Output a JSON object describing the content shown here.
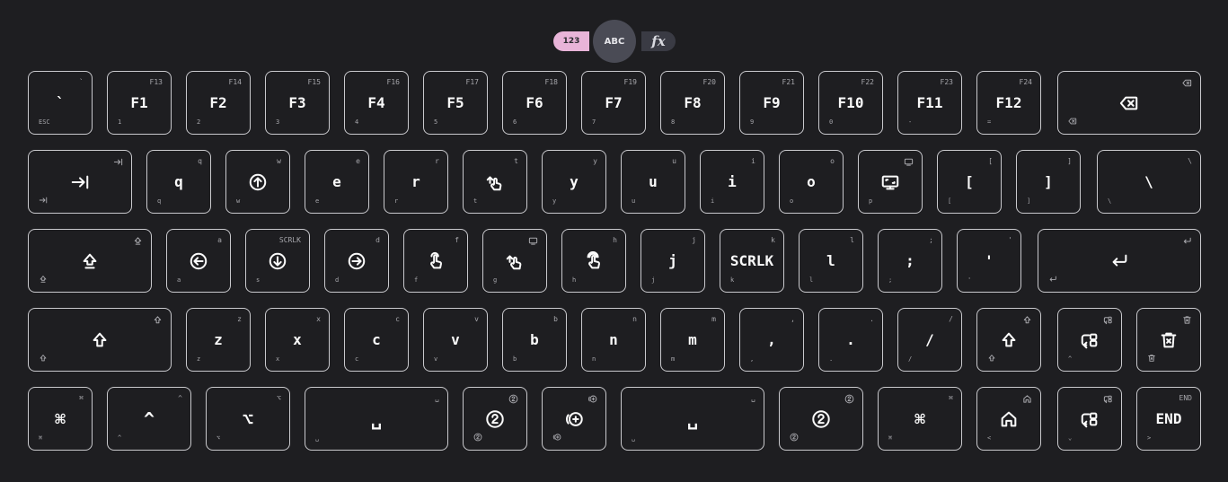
{
  "layers": {
    "num": "123",
    "abc": "ABC",
    "fx": "fx"
  },
  "rows": [
    [
      {
        "name": "key-backtick",
        "main": "`",
        "tr": "`",
        "bl": "ESC"
      },
      {
        "name": "key-f1",
        "main": "F1",
        "tr": "F13",
        "bl": "1"
      },
      {
        "name": "key-f2",
        "main": "F2",
        "tr": "F14",
        "bl": "2"
      },
      {
        "name": "key-f3",
        "main": "F3",
        "tr": "F15",
        "bl": "3"
      },
      {
        "name": "key-f4",
        "main": "F4",
        "tr": "F16",
        "bl": "4"
      },
      {
        "name": "key-f5",
        "main": "F5",
        "tr": "F17",
        "bl": "5"
      },
      {
        "name": "key-f6",
        "main": "F6",
        "tr": "F18",
        "bl": "6"
      },
      {
        "name": "key-f7",
        "main": "F7",
        "tr": "F19",
        "bl": "7"
      },
      {
        "name": "key-f8",
        "main": "F8",
        "tr": "F20",
        "bl": "8"
      },
      {
        "name": "key-f9",
        "main": "F9",
        "tr": "F21",
        "bl": "9"
      },
      {
        "name": "key-f10",
        "main": "F10",
        "tr": "F22",
        "bl": "0"
      },
      {
        "name": "key-f11",
        "main": "F11",
        "tr": "F23",
        "bl": "-"
      },
      {
        "name": "key-f12",
        "main": "F12",
        "tr": "F24",
        "bl": "="
      },
      {
        "name": "key-backspace",
        "icon": "backspace-icon",
        "trIcon": "backspace-icon",
        "blIcon": "backspace-icon"
      }
    ],
    [
      {
        "name": "key-tab",
        "icon": "tab-icon",
        "trIcon": "tab-icon",
        "blIcon": "tab-icon"
      },
      {
        "name": "key-q",
        "main": "q",
        "tr": "q",
        "bl": "q"
      },
      {
        "name": "key-w",
        "icon": "mouse-up-icon",
        "tr": "w",
        "bl": "w"
      },
      {
        "name": "key-e",
        "main": "e",
        "tr": "e",
        "bl": "e"
      },
      {
        "name": "key-r",
        "main": "r",
        "tr": "r",
        "bl": "r"
      },
      {
        "name": "key-t",
        "icon": "swipe-up-icon",
        "tr": "t",
        "bl": "t"
      },
      {
        "name": "key-y",
        "main": "y",
        "tr": "y",
        "bl": "y"
      },
      {
        "name": "key-u",
        "main": "u",
        "tr": "u",
        "bl": "u"
      },
      {
        "name": "key-i",
        "main": "i",
        "tr": "i",
        "bl": "i"
      },
      {
        "name": "key-o",
        "main": "o",
        "tr": "o",
        "bl": "o"
      },
      {
        "name": "key-p",
        "icon": "screen-icon",
        "trIcon": "screen-small-icon",
        "bl": "p"
      },
      {
        "name": "key-lbracket",
        "main": "[",
        "tr": "[",
        "bl": "["
      },
      {
        "name": "key-rbracket",
        "main": "]",
        "tr": "]",
        "bl": "]"
      },
      {
        "name": "key-backslash",
        "main": "\\",
        "tr": "\\",
        "bl": "\\"
      }
    ],
    [
      {
        "name": "key-capslock",
        "icon": "caps-icon",
        "trIcon": "caps-icon",
        "blIcon": "caps-icon"
      },
      {
        "name": "key-a",
        "icon": "mouse-left-icon",
        "tr": "a",
        "bl": "a"
      },
      {
        "name": "key-s",
        "icon": "mouse-down-icon",
        "tr": "SCRLK",
        "bl": "s"
      },
      {
        "name": "key-d",
        "icon": "mouse-right-icon",
        "tr": "d",
        "bl": "d"
      },
      {
        "name": "key-f",
        "icon": "tap-icon",
        "tr": "f",
        "bl": "f"
      },
      {
        "name": "key-g",
        "icon": "swipe-up-icon",
        "trIcon": "screen-small-icon",
        "bl": "g"
      },
      {
        "name": "key-h",
        "icon": "tap-double-icon",
        "tr": "h",
        "bl": "h"
      },
      {
        "name": "key-j",
        "main": "j",
        "tr": "j",
        "bl": "j"
      },
      {
        "name": "key-k",
        "main": "SCRLK",
        "tr": "k",
        "bl": "k"
      },
      {
        "name": "key-l",
        "main": "l",
        "tr": "l",
        "bl": "l"
      },
      {
        "name": "key-semicolon",
        "main": ";",
        "tr": ";",
        "bl": ";"
      },
      {
        "name": "key-quote",
        "main": "'",
        "tr": "'",
        "bl": "'"
      },
      {
        "name": "key-enter",
        "icon": "enter-icon",
        "trIcon": "enter-icon",
        "blIcon": "enter-icon"
      }
    ],
    [
      {
        "name": "key-lshift",
        "icon": "shift-icon",
        "trIcon": "shift-icon",
        "blIcon": "shift-icon"
      },
      {
        "name": "key-z",
        "main": "z",
        "tr": "z",
        "bl": "z"
      },
      {
        "name": "key-x",
        "main": "x",
        "tr": "x",
        "bl": "x"
      },
      {
        "name": "key-c",
        "main": "c",
        "tr": "c",
        "bl": "c"
      },
      {
        "name": "key-v",
        "main": "v",
        "tr": "v",
        "bl": "v"
      },
      {
        "name": "key-b",
        "main": "b",
        "tr": "b",
        "bl": "b"
      },
      {
        "name": "key-n",
        "main": "n",
        "tr": "n",
        "bl": "n"
      },
      {
        "name": "key-m",
        "main": "m",
        "tr": "m",
        "bl": "m"
      },
      {
        "name": "key-comma",
        "main": ",",
        "tr": ",",
        "bl": ","
      },
      {
        "name": "key-period",
        "main": ".",
        "tr": ".",
        "bl": "."
      },
      {
        "name": "key-slash",
        "main": "/",
        "tr": "/",
        "bl": "/"
      },
      {
        "name": "key-rshift",
        "icon": "shift-icon",
        "trIcon": "shift-icon",
        "blIcon": "shift-icon"
      },
      {
        "name": "key-swap-layer",
        "icon": "swap-icon",
        "trIcon": "swap-icon",
        "bl": "^"
      },
      {
        "name": "key-clear",
        "icon": "delete-icon",
        "trIcon": "delete-icon",
        "blIcon": "delete-icon"
      }
    ],
    [
      {
        "name": "key-lcmd",
        "main": "⌘",
        "tr": "⌘",
        "bl": "⌘"
      },
      {
        "name": "key-ctrl",
        "main": "^",
        "tr": "^",
        "bl": "^"
      },
      {
        "name": "key-alt",
        "main": "⌥",
        "tr": "⌥",
        "bl": "⌥"
      },
      {
        "name": "key-lspace",
        "main": "␣",
        "tr": "␣",
        "bl": "␣"
      },
      {
        "name": "key-layer2",
        "icon": "layer2-icon",
        "trIcon": "layer2-icon",
        "blIcon": "layer2-icon"
      },
      {
        "name": "key-add-layer",
        "icon": "add-layer-icon",
        "trIcon": "add-layer-icon",
        "blIcon": "add-layer-icon"
      },
      {
        "name": "key-rspace",
        "main": "␣",
        "tr": "␣",
        "bl": "␣"
      },
      {
        "name": "key-layer2-right",
        "icon": "layer2-icon",
        "trIcon": "layer2-icon",
        "blIcon": "layer2-icon"
      },
      {
        "name": "key-rcmd",
        "main": "⌘",
        "tr": "⌘",
        "bl": "⌘"
      },
      {
        "name": "key-home",
        "icon": "home-icon",
        "trIcon": "home-icon",
        "bl": "<"
      },
      {
        "name": "key-swap-layer-2",
        "icon": "swap-icon",
        "trIcon": "swap-icon",
        "bl": "⌄"
      },
      {
        "name": "key-end",
        "main": "END",
        "tr": "END",
        "bl": ">"
      }
    ]
  ]
}
